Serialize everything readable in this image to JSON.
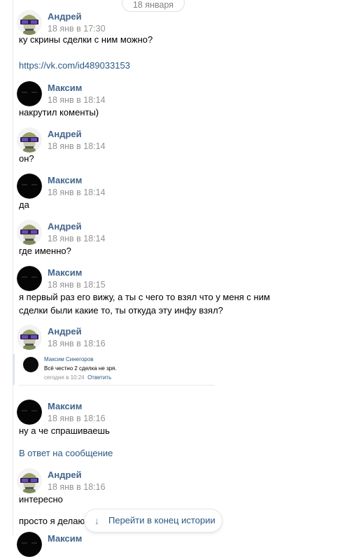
{
  "date_divider": "18 января",
  "messages": [
    {
      "author": "Андрей",
      "time": "18 янв в 17:30",
      "avatar": "andrey",
      "lines": [
        "ку скрины сделки с ним можно?"
      ],
      "link": "https://vk.com/id489033153"
    },
    {
      "author": "Максим",
      "time": "18 янв в 18:14",
      "avatar": "maxim",
      "lines": [
        "накрутил коменты)"
      ]
    },
    {
      "author": "Андрей",
      "time": "18 янв в 18:14",
      "avatar": "andrey",
      "lines": [
        "он?"
      ]
    },
    {
      "author": "Максим",
      "time": "18 янв в 18:14",
      "avatar": "maxim",
      "lines": [
        "да"
      ]
    },
    {
      "author": "Андрей",
      "time": "18 янв в 18:14",
      "avatar": "andrey",
      "lines": [
        "где именно?"
      ]
    },
    {
      "author": "Максим",
      "time": "18 янв в 18:15",
      "avatar": "maxim",
      "lines": [
        "я первый раз его вижу, а ты с чего то взял что у меня с ним",
        "сделки были какие то, ты откуда эту инфу взял?"
      ]
    },
    {
      "author": "Андрей",
      "time": "18 янв в 18:16",
      "avatar": "andrey",
      "lines": []
    },
    {
      "author": "Максим",
      "time": "18 янв в 18:16",
      "avatar": "maxim",
      "lines": [
        "ну а че спрашиваешь"
      ],
      "reply_link": "В ответ на сообщение"
    },
    {
      "author": "Андрей",
      "time": "18 янв в 18:16",
      "avatar": "andrey",
      "lines": [
        "интересно",
        "просто я делаю"
      ]
    },
    {
      "author": "Максим",
      "avatar": "maxim",
      "lines": []
    }
  ],
  "forwarded_comment": {
    "author": "Максим Синегоров",
    "text": "Всё честно 2 сделка не зря.",
    "time": "сегодня в 10:24",
    "reply_label": "Ответить"
  },
  "jump_button": {
    "label": "Перейти в конец истории",
    "icon": "arrow-down-icon"
  },
  "colors": {
    "author": "#42648b",
    "link": "#2a5885",
    "time": "#939393",
    "divider": "#e7e8ec"
  }
}
